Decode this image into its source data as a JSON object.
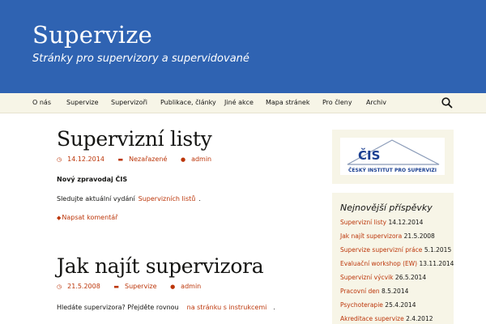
{
  "header": {
    "site_title": "Supervize",
    "site_description": "Stránky pro supervizory a supervidované"
  },
  "nav": {
    "items": [
      "O nás",
      "Supervize",
      "Supervizoři",
      "Publikace, články",
      "Jiné akce",
      "Mapa stránek",
      "Pro členy",
      "Archiv"
    ]
  },
  "posts": [
    {
      "title": "Supervizní listy",
      "date": "14.12.2014",
      "category": "Nezařazené",
      "author": "admin",
      "strong_text": "Nový zpravodaj ČIS",
      "text_before_link": "Sledujte aktuální vydání",
      "link_text": "Supervizních listů",
      "text_after_link": ".",
      "comment_link": "Napsat komentář"
    },
    {
      "title": "Jak najít supervizora",
      "date": "21.5.2008",
      "category": "Supervize",
      "author": "admin",
      "text_before_link": "Hledáte supervizora? Přejděte rovnou",
      "link_text": "na stránku s instrukcemi",
      "text_after_link": "."
    }
  ],
  "sidebar": {
    "logo": {
      "letters": "ČIS",
      "text": "ČESKÝ INSTITUT PRO SUPERVIZI"
    },
    "recent_title": "Nejnovější příspěvky",
    "recent_posts": [
      {
        "title": "Supervizní listy",
        "date": "14.12.2014"
      },
      {
        "title": "Jak najít supervizora",
        "date": "21.5.2008"
      },
      {
        "title": "Supervize supervizní práce",
        "date": "5.1.2015"
      },
      {
        "title": "Evaluační workshop (EW)",
        "date": "13.11.2014"
      },
      {
        "title": "Supervizní výcvik",
        "date": "26.5.2014"
      },
      {
        "title": "Pracovní den",
        "date": "8.5.2014"
      },
      {
        "title": "Psychoterapie",
        "date": "25.4.2014"
      },
      {
        "title": "Akreditace supervize",
        "date": "2.4.2012"
      }
    ]
  },
  "colors": {
    "header_bg": "#2f63b2",
    "nav_bg": "#f7f5e7",
    "link": "#bc360a",
    "logo_blue": "#1a3f91"
  },
  "icons": {
    "search": "search-icon",
    "date": "clock-icon",
    "category": "folder-icon",
    "author": "user-icon",
    "comment": "comment-icon"
  }
}
